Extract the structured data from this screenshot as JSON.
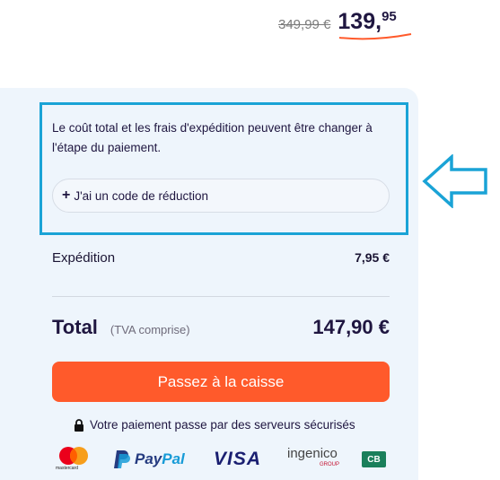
{
  "price": {
    "old_price": "349,99 €",
    "new_price_int": "139,",
    "new_price_cents": "95"
  },
  "summary": {
    "info_text": "Le coût total et les frais d'expédition peuvent être changer à l'étape du paiement.",
    "promo_plus": "+",
    "promo_label": "J'ai un code de réduction",
    "shipping_label": "Expédition",
    "shipping_value": "7,95 €",
    "total_label": "Total",
    "vat_label": "(TVA comprise)",
    "total_value": "147,90 €",
    "checkout_label": "Passez à la caisse",
    "secure_text": "Votre paiement passe par des serveurs sécurisés"
  },
  "payment_logos": {
    "mastercard": "mastercard",
    "paypal_pay": "Pay",
    "paypal_pal": "Pal",
    "visa": "VISA",
    "ingenico": "ingenico",
    "ingenico_group": "GROUP",
    "cb": "CB"
  },
  "colors": {
    "accent": "#ff5a2b",
    "highlight": "#1aa3d6",
    "panel_bg": "#eef5fc",
    "text_dark": "#1f1640"
  },
  "icons": [
    "plus-icon",
    "arrow-left-icon",
    "lock-icon",
    "mastercard-icon",
    "paypal-icon"
  ]
}
